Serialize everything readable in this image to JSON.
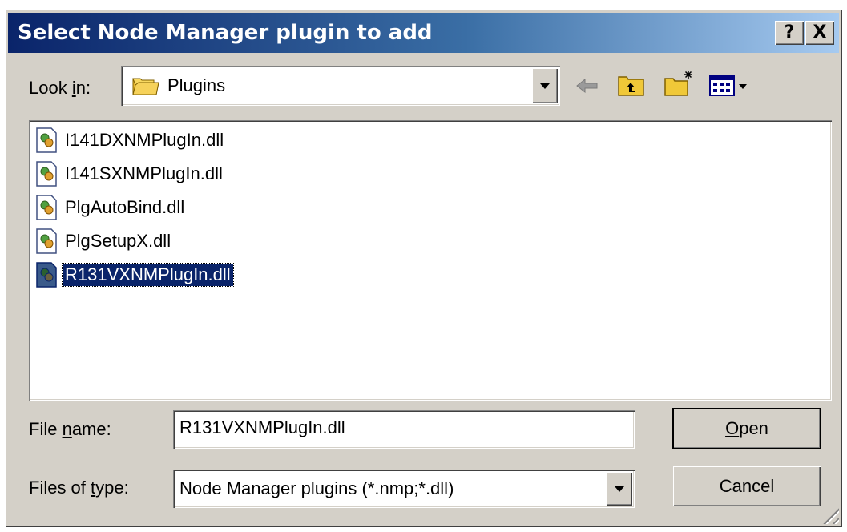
{
  "window": {
    "title": "Select Node Manager plugin to add",
    "help_glyph": "?",
    "close_glyph": "X"
  },
  "look_in": {
    "label_prefix": "Look ",
    "label_key": "i",
    "label_suffix": "n:",
    "value": "Plugins",
    "icon": "folder-icon"
  },
  "toolbar": {
    "back_icon": "back-arrow-icon",
    "up_icon": "up-one-level-icon",
    "new_folder_icon": "new-folder-icon",
    "view_icon": "view-menu-icon"
  },
  "files": [
    {
      "name": "I141DXNMPlugIn.dll",
      "selected": false
    },
    {
      "name": "I141SXNMPlugIn.dll",
      "selected": false
    },
    {
      "name": "PlgAutoBind.dll",
      "selected": false
    },
    {
      "name": "PlgSetupX.dll",
      "selected": false
    },
    {
      "name": "R131VXNMPlugIn.dll",
      "selected": true
    }
  ],
  "file_name": {
    "label_prefix": "File ",
    "label_key": "n",
    "label_suffix": "ame:",
    "value": "R131VXNMPlugIn.dll"
  },
  "file_type": {
    "label_prefix": "Files of ",
    "label_key": "t",
    "label_suffix": "ype:",
    "value": "Node Manager plugins (*.nmp;*.dll)"
  },
  "buttons": {
    "open_key": "O",
    "open_rest": "pen",
    "cancel": "Cancel"
  },
  "colors": {
    "title_start": "#0a246a",
    "title_end": "#a6caf0",
    "selection": "#0a246a",
    "dialog_bg": "#d4d0c8"
  }
}
